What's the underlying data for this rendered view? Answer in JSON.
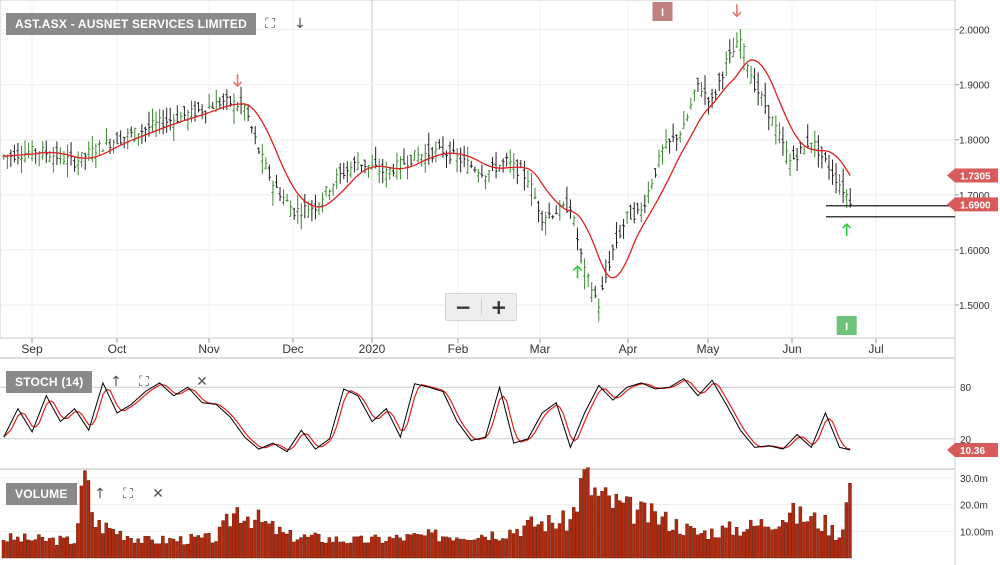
{
  "panels": {
    "price": {
      "label": "AST.ASX - AUSNET SERVICES LIMITED"
    },
    "stoch": {
      "label": "STOCH (14)"
    },
    "volume": {
      "label": "VOLUME"
    }
  },
  "zoom": {
    "minus": "−",
    "plus": "+"
  },
  "icons": {
    "price": [
      "expand-icon",
      "download-icon"
    ],
    "stoch": [
      "move-up-icon",
      "expand-icon",
      "close-icon"
    ],
    "volume": [
      "move-up-icon",
      "expand-icon",
      "close-icon"
    ]
  },
  "colors": {
    "bar_up": "#3a8a2e",
    "bar_down": "#222222",
    "ma": "#e02020",
    "stoch_k": "#000000",
    "stoch_d": "#e02020",
    "volume": "#b22a0e",
    "arrow_down": "#e5736e",
    "arrow_up": "#2ecc40",
    "badge_red": "#d85a5a",
    "marker_pink": "#c08080",
    "marker_green": "#6fc27a"
  },
  "chart_data": [
    {
      "type": "ohlc",
      "title": "AST.ASX - AUSNET SERVICES LIMITED",
      "x_ticks": [
        "Sep",
        "Oct",
        "Nov",
        "Dec",
        "2020",
        "Feb",
        "Mar",
        "Apr",
        "May",
        "Jun",
        "Jul"
      ],
      "y_ticks": [
        "1.5000",
        "1.6000",
        "1.7000",
        "1.8000",
        "1.9000",
        "2.0000"
      ],
      "ylim": [
        1.44,
        2.05
      ],
      "grid": true,
      "close_anchors": [
        [
          0,
          1.77
        ],
        [
          10,
          1.78
        ],
        [
          20,
          1.76
        ],
        [
          28,
          1.79
        ],
        [
          36,
          1.81
        ],
        [
          44,
          1.83
        ],
        [
          54,
          1.85
        ],
        [
          62,
          1.87
        ],
        [
          68,
          1.86
        ],
        [
          72,
          1.78
        ],
        [
          76,
          1.72
        ],
        [
          82,
          1.67
        ],
        [
          88,
          1.68
        ],
        [
          94,
          1.73
        ],
        [
          100,
          1.76
        ],
        [
          108,
          1.74
        ],
        [
          116,
          1.77
        ],
        [
          124,
          1.78
        ],
        [
          130,
          1.76
        ],
        [
          136,
          1.74
        ],
        [
          142,
          1.76
        ],
        [
          148,
          1.73
        ],
        [
          152,
          1.66
        ],
        [
          160,
          1.68
        ],
        [
          164,
          1.56
        ],
        [
          168,
          1.5
        ],
        [
          172,
          1.6
        ],
        [
          176,
          1.66
        ],
        [
          180,
          1.67
        ],
        [
          186,
          1.78
        ],
        [
          192,
          1.82
        ],
        [
          196,
          1.9
        ],
        [
          200,
          1.87
        ],
        [
          204,
          1.94
        ],
        [
          208,
          1.98
        ],
        [
          212,
          1.9
        ],
        [
          216,
          1.85
        ],
        [
          222,
          1.76
        ],
        [
          228,
          1.8
        ],
        [
          232,
          1.76
        ],
        [
          236,
          1.72
        ],
        [
          239,
          1.69
        ]
      ],
      "ma_period": 10,
      "last_ma_label": "1.7305",
      "last_price_label": "1.6900",
      "horizontal_lines": [
        1.68,
        1.66
      ],
      "signals": [
        {
          "index": 66,
          "kind": "sell"
        },
        {
          "index": 207,
          "kind": "sell"
        },
        {
          "index": 162,
          "kind": "buy"
        },
        {
          "index": 238,
          "kind": "buy"
        }
      ],
      "markers": [
        {
          "index": 186,
          "kind": "top",
          "label": "I"
        },
        {
          "index": 238,
          "kind": "bottom",
          "label": "I"
        }
      ]
    },
    {
      "type": "line",
      "title": "STOCH (14)",
      "y_ticks": [
        "20",
        "80"
      ],
      "ylim": [
        0,
        100
      ],
      "series": [
        {
          "role": "%K"
        },
        {
          "role": "%D"
        }
      ],
      "k_anchors": [
        [
          0,
          22
        ],
        [
          4,
          55
        ],
        [
          8,
          28
        ],
        [
          12,
          70
        ],
        [
          16,
          40
        ],
        [
          20,
          55
        ],
        [
          24,
          30
        ],
        [
          28,
          85
        ],
        [
          32,
          50
        ],
        [
          36,
          60
        ],
        [
          40,
          75
        ],
        [
          44,
          85
        ],
        [
          48,
          70
        ],
        [
          52,
          80
        ],
        [
          56,
          62
        ],
        [
          60,
          60
        ],
        [
          64,
          45
        ],
        [
          68,
          22
        ],
        [
          72,
          8
        ],
        [
          76,
          15
        ],
        [
          80,
          5
        ],
        [
          84,
          30
        ],
        [
          88,
          8
        ],
        [
          92,
          20
        ],
        [
          96,
          78
        ],
        [
          100,
          70
        ],
        [
          104,
          40
        ],
        [
          108,
          55
        ],
        [
          112,
          22
        ],
        [
          116,
          84
        ],
        [
          120,
          80
        ],
        [
          124,
          75
        ],
        [
          128,
          40
        ],
        [
          132,
          18
        ],
        [
          136,
          22
        ],
        [
          140,
          80
        ],
        [
          144,
          15
        ],
        [
          148,
          20
        ],
        [
          152,
          50
        ],
        [
          156,
          62
        ],
        [
          160,
          10
        ],
        [
          164,
          50
        ],
        [
          168,
          82
        ],
        [
          172,
          65
        ],
        [
          176,
          80
        ],
        [
          180,
          85
        ],
        [
          184,
          78
        ],
        [
          188,
          80
        ],
        [
          192,
          90
        ],
        [
          196,
          70
        ],
        [
          200,
          88
        ],
        [
          204,
          60
        ],
        [
          208,
          30
        ],
        [
          212,
          10
        ],
        [
          216,
          12
        ],
        [
          220,
          8
        ],
        [
          224,
          25
        ],
        [
          228,
          10
        ],
        [
          232,
          50
        ],
        [
          236,
          10
        ],
        [
          239,
          7
        ]
      ],
      "last_label": "10.36"
    },
    {
      "type": "bar",
      "title": "VOLUME",
      "y_ticks": [
        "10.00m",
        "20.0m",
        "30.0m"
      ],
      "ylim": [
        0,
        33
      ],
      "vol_anchors": [
        [
          0,
          8
        ],
        [
          20,
          7
        ],
        [
          23,
          33
        ],
        [
          26,
          14
        ],
        [
          40,
          7
        ],
        [
          60,
          8
        ],
        [
          66,
          20
        ],
        [
          80,
          9
        ],
        [
          100,
          7
        ],
        [
          120,
          9
        ],
        [
          140,
          10
        ],
        [
          150,
          14
        ],
        [
          160,
          15
        ],
        [
          164,
          33
        ],
        [
          168,
          25
        ],
        [
          176,
          20
        ],
        [
          188,
          15
        ],
        [
          196,
          10
        ],
        [
          212,
          13
        ],
        [
          222,
          18
        ],
        [
          228,
          16
        ],
        [
          232,
          14
        ],
        [
          236,
          9
        ],
        [
          239,
          29
        ]
      ]
    }
  ]
}
